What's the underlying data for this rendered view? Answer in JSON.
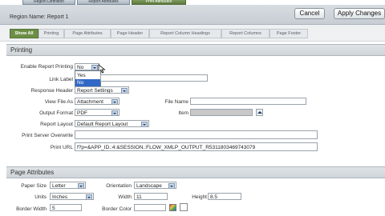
{
  "tabs": [
    "Region Definition",
    "Report Attributes",
    "Print Attributes"
  ],
  "region": {
    "label": "Region Name:",
    "name": "Report 1"
  },
  "buttons": {
    "cancel": "Cancel",
    "apply": "Apply Changes"
  },
  "show_tabs": [
    "Show All",
    "Printing",
    "Page Attributes",
    "Page Header",
    "Report Column Headings",
    "Report Columns",
    "Page Footer"
  ],
  "printing": {
    "title": "Printing",
    "enable_label": "Enable Report Printing",
    "enable_value": "No",
    "dropdown_options": [
      "Yes",
      "No"
    ],
    "link_label": "Link Label",
    "response_label": "Response Header",
    "response_value": "Report Settings",
    "view_file_label": "View File As",
    "view_file_value": "Attachment",
    "file_name_label": "File Name",
    "output_label": "Output Format",
    "output_value": "PDF",
    "item_label": "Item",
    "layout_label": "Report Layout",
    "layout_value": "Default Report Layout",
    "server_label": "Print Server Overwrite",
    "url_label": "Print URL",
    "url_value": "f?p=&APP_ID.:4:&SESSION.:FLOW_XMLP_OUTPUT_R5311803469743079"
  },
  "page_attributes": {
    "title": "Page Attributes",
    "paper_label": "Paper Size",
    "paper_value": "Letter",
    "orientation_label": "Orientation",
    "orientation_value": "Landscape",
    "units_label": "Units",
    "units_value": "Inches",
    "width_label": "Width",
    "width_value": "11",
    "height_label": "Height",
    "height_value": "8.5",
    "border_width_label": "Border Width",
    "border_width_value": "5",
    "border_color_label": "Border Color"
  }
}
